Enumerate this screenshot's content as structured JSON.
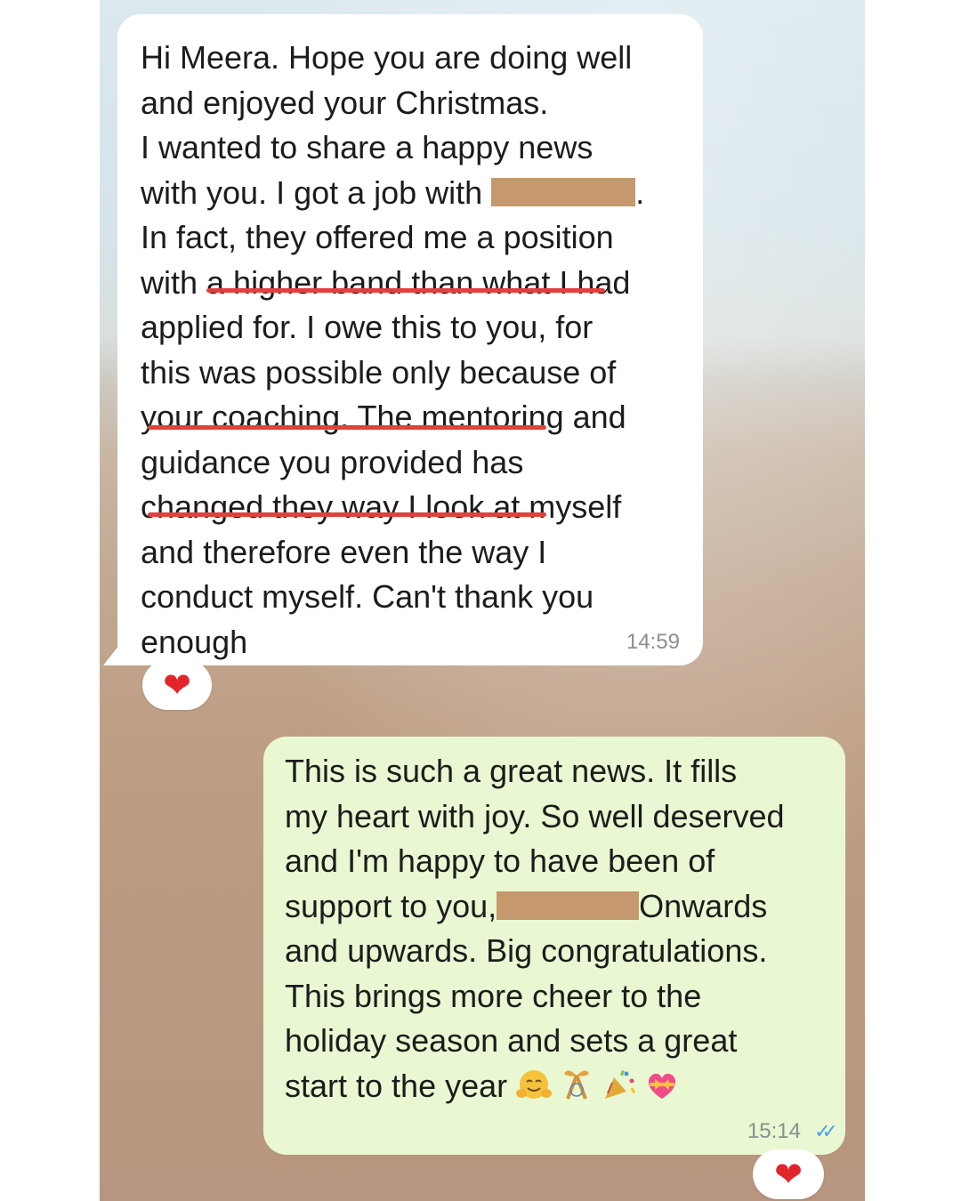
{
  "incoming": {
    "lines": [
      "Hi Meera. Hope you are doing well",
      "and enjoyed your Christmas.",
      "I wanted to share a happy news",
      "with you. I got a job with",
      "In fact, they offered me a position",
      "with a higher band than what I had",
      "applied for. I owe this to you, for",
      "this was possible only because of",
      "your coaching. The mentoring and",
      "guidance you provided has",
      "changed they way I look at myself",
      "and therefore even the way I",
      "conduct myself. Can't thank you",
      "enough"
    ],
    "line4_suffix": ".",
    "time": "14:59",
    "reaction": "❤"
  },
  "outgoing": {
    "lines": [
      "This is such a great news. It fills",
      "my heart with joy. So well deserved",
      "and I'm happy to have been of",
      "support to you,",
      "and upwards. Big congratulations.",
      "This brings more cheer to the",
      "holiday season and sets a great",
      "start to the year"
    ],
    "line4_after_redaction": "Onwards",
    "emoji_icons": [
      "hugging-face-icon",
      "gift-ribbon-icon",
      "party-popper-icon",
      "heart-with-ribbon-icon"
    ],
    "time": "15:14",
    "ticks": "✓✓",
    "reaction": "❤"
  },
  "colors": {
    "incoming_bubble": "#ffffff",
    "outgoing_bubble": "#e9f8d2",
    "underline": "#e0413c",
    "redaction": "#c5986d",
    "read_ticks": "#4ba3e3",
    "heart": "#e1252b"
  }
}
